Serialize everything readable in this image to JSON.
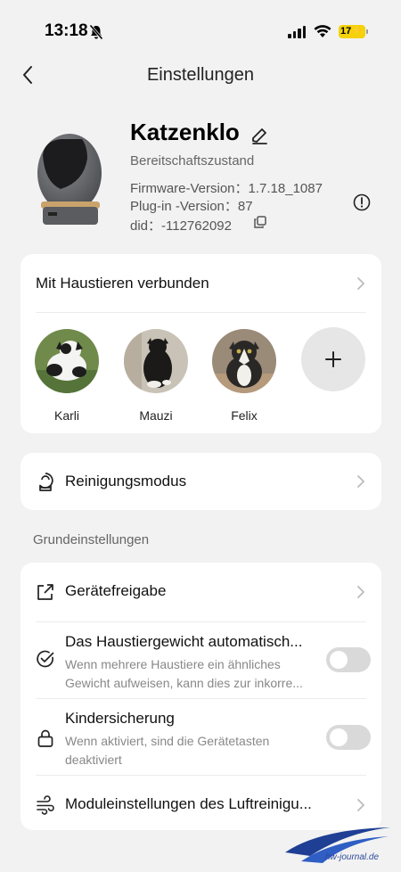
{
  "status_bar": {
    "time": "13:18",
    "battery": "17"
  },
  "nav": {
    "title": "Einstellungen"
  },
  "device": {
    "name": "Katzenklo",
    "status": "Bereitschaftszustand",
    "firmware": "Firmware-Version：1.7.18_1087",
    "plugin": "Plug-in -Version：87",
    "did": "did：-112762092"
  },
  "pets": {
    "header": "Mit Haustieren verbunden",
    "items": [
      {
        "name": "Karli"
      },
      {
        "name": "Mauzi"
      },
      {
        "name": "Felix"
      }
    ]
  },
  "cleaning": {
    "label": "Reinigungsmodus"
  },
  "basic": {
    "section_label": "Grundeinstellungen",
    "share": {
      "label": "Gerätefreigabe"
    },
    "auto_weight": {
      "label": "Das Haustiergewicht automatisch...",
      "desc1": "Wenn mehrere Haustiere ein ähnliches",
      "desc2": "Gewicht aufweisen, kann dies zur inkorre...",
      "enabled": false
    },
    "child_lock": {
      "label": "Kindersicherung",
      "desc1": "Wenn aktiviert, sind die Gerätetasten",
      "desc2": "deaktiviert",
      "enabled": false
    },
    "air": {
      "label": "Moduleinstellungen des Luftreinigu..."
    }
  },
  "watermark": {
    "text": "hw-journal.de"
  }
}
